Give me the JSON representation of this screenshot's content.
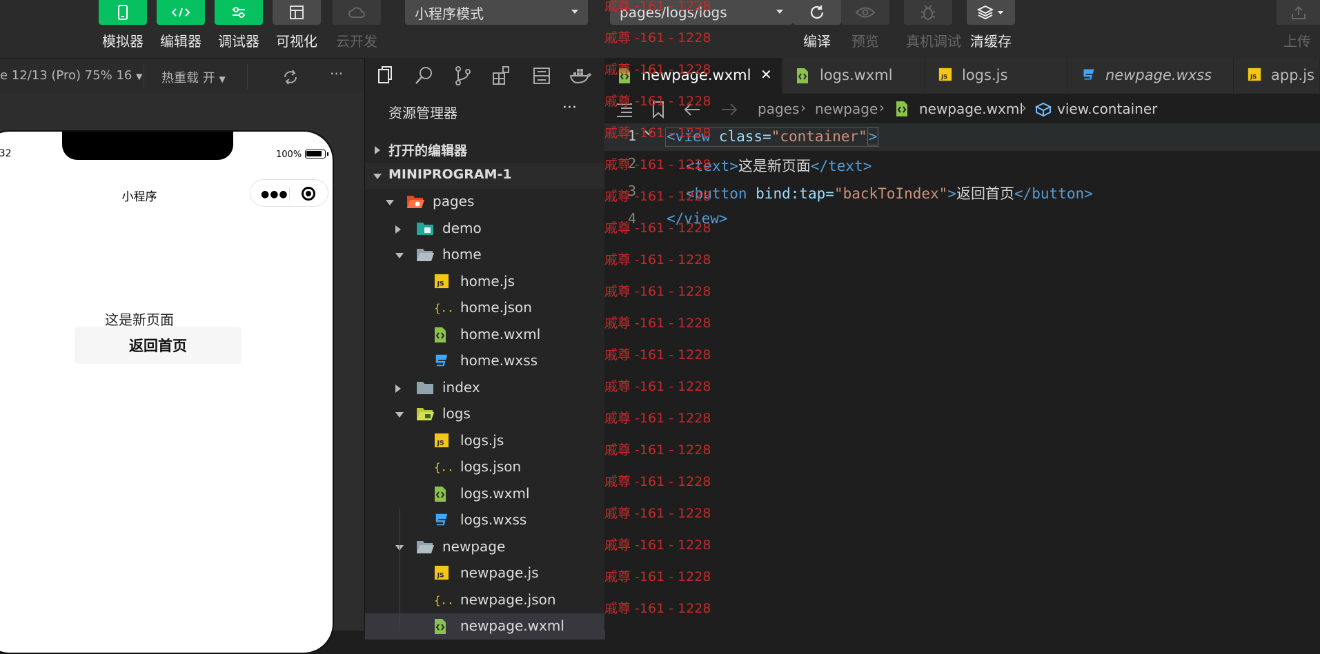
{
  "toolbar": {
    "simulator_label": "模拟器",
    "editor_label": "编辑器",
    "debugger_label": "调试器",
    "visual_label": "可视化",
    "cloud_label": "云开发",
    "mode_select": "小程序模式",
    "page_select": "pages/logs/logs",
    "compile_label": "编译",
    "preview_label": "预览",
    "remote_debug_label": "真机调试",
    "clear_cache_label": "清缓存",
    "upload_label": "上传"
  },
  "simulator_bar": {
    "device": "e 12/13 (Pro) 75% 16",
    "hot_reload": "热重载 开",
    "more": "···"
  },
  "phone": {
    "time": ":32",
    "battery": "100%",
    "nav_title": "小程序",
    "capsule_dots": "●●●",
    "page_text": "这是新页面",
    "back_button": "返回首页"
  },
  "explorer": {
    "title": "资源管理器",
    "more": "···",
    "open_editors": "打开的编辑器",
    "project": "MINIPROGRAM-1",
    "tree": [
      {
        "label": "pages",
        "indent": 1,
        "type": "folder-open-special",
        "arrow": "down"
      },
      {
        "label": "demo",
        "indent": 2,
        "type": "folder-special",
        "arrow": "right"
      },
      {
        "label": "home",
        "indent": 2,
        "type": "folder-open",
        "arrow": "down"
      },
      {
        "label": "home.js",
        "indent": 3,
        "type": "js"
      },
      {
        "label": "home.json",
        "indent": 3,
        "type": "json"
      },
      {
        "label": "home.wxml",
        "indent": 3,
        "type": "wxml"
      },
      {
        "label": "home.wxss",
        "indent": 3,
        "type": "wxss"
      },
      {
        "label": "index",
        "indent": 2,
        "type": "folder",
        "arrow": "right"
      },
      {
        "label": "logs",
        "indent": 2,
        "type": "folder-open-logs",
        "arrow": "down"
      },
      {
        "label": "logs.js",
        "indent": 3,
        "type": "js"
      },
      {
        "label": "logs.json",
        "indent": 3,
        "type": "json"
      },
      {
        "label": "logs.wxml",
        "indent": 3,
        "type": "wxml"
      },
      {
        "label": "logs.wxss",
        "indent": 3,
        "type": "wxss"
      },
      {
        "label": "newpage",
        "indent": 2,
        "type": "folder-open",
        "arrow": "down"
      },
      {
        "label": "newpage.js",
        "indent": 3,
        "type": "js"
      },
      {
        "label": "newpage.json",
        "indent": 3,
        "type": "json"
      },
      {
        "label": "newpage.wxml",
        "indent": 3,
        "type": "wxml",
        "selected": true
      }
    ]
  },
  "editor": {
    "tabs": [
      {
        "label": "newpage.wxml",
        "type": "wxml",
        "active": true,
        "close": "✕"
      },
      {
        "label": "logs.wxml",
        "type": "wxml"
      },
      {
        "label": "logs.js",
        "type": "js"
      },
      {
        "label": "newpage.wxss",
        "type": "wxss",
        "italic": true
      },
      {
        "label": "app.js",
        "type": "js"
      }
    ],
    "breadcrumb": {
      "seg1": "pages",
      "seg2": "newpage",
      "seg3": "newpage.wxml",
      "seg4": "view.container"
    },
    "code": {
      "line1": {
        "num": "1",
        "open": "<view ",
        "attr": "class=",
        "str": "\"container\"",
        "close": ">"
      },
      "line2": {
        "num": "2",
        "open": "<text>",
        "text": "这是新页面",
        "close": "</text>"
      },
      "line3": {
        "num": "3",
        "open": "<button ",
        "attr": "bind:tap=",
        "str": "\"backToIndex\"",
        "mid": ">",
        "text": "返回首页",
        "close": "</button>"
      },
      "line4": {
        "num": "4",
        "close": "</view>"
      }
    }
  },
  "watermark": {
    "text": "戚尊 -161 - 1228",
    "count": 20
  },
  "colors": {
    "green": "#07c160",
    "watermark": "#c42b2b",
    "tag": "#569cd6",
    "string": "#ce9178"
  }
}
